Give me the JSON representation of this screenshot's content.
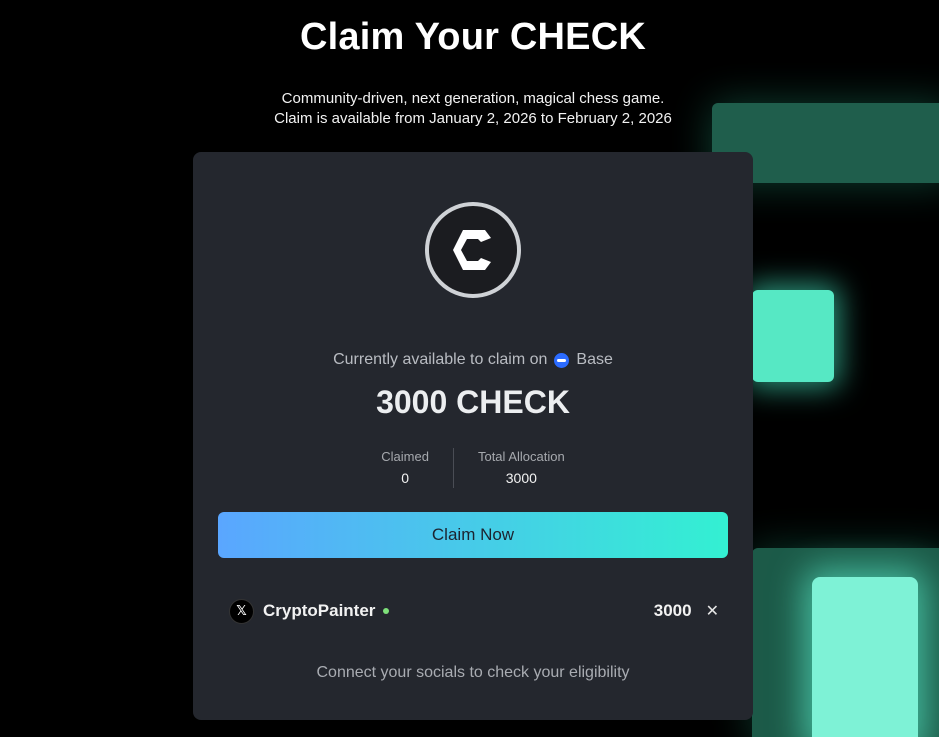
{
  "header": {
    "title": "Claim Your CHECK",
    "subtitle_line1": "Community-driven, next generation, magical chess game.",
    "subtitle_line2": "Claim is available from January 2, 2026 to February 2, 2026"
  },
  "card": {
    "available_label": "Currently available to claim on",
    "network_name": "Base",
    "network_icon": "base-icon",
    "amount": "3000 CHECK",
    "stats": [
      {
        "label": "Claimed",
        "value": "0"
      },
      {
        "label": "Total Allocation",
        "value": "3000"
      }
    ],
    "claim_button": "Claim Now",
    "social": {
      "icon": "x-icon",
      "icon_glyph": "𝕏",
      "username": "CryptoPainter",
      "amount": "3000",
      "remove_glyph": "✕"
    },
    "connect_text": "Connect your socials to check your eligibility"
  },
  "colors": {
    "background": "#000000",
    "card": "#24272e",
    "button_gradient_start": "#5aa6ff",
    "button_gradient_end": "#33f0d2",
    "accent_glow": "#56e8c4",
    "status_dot": "#7ee07a"
  }
}
